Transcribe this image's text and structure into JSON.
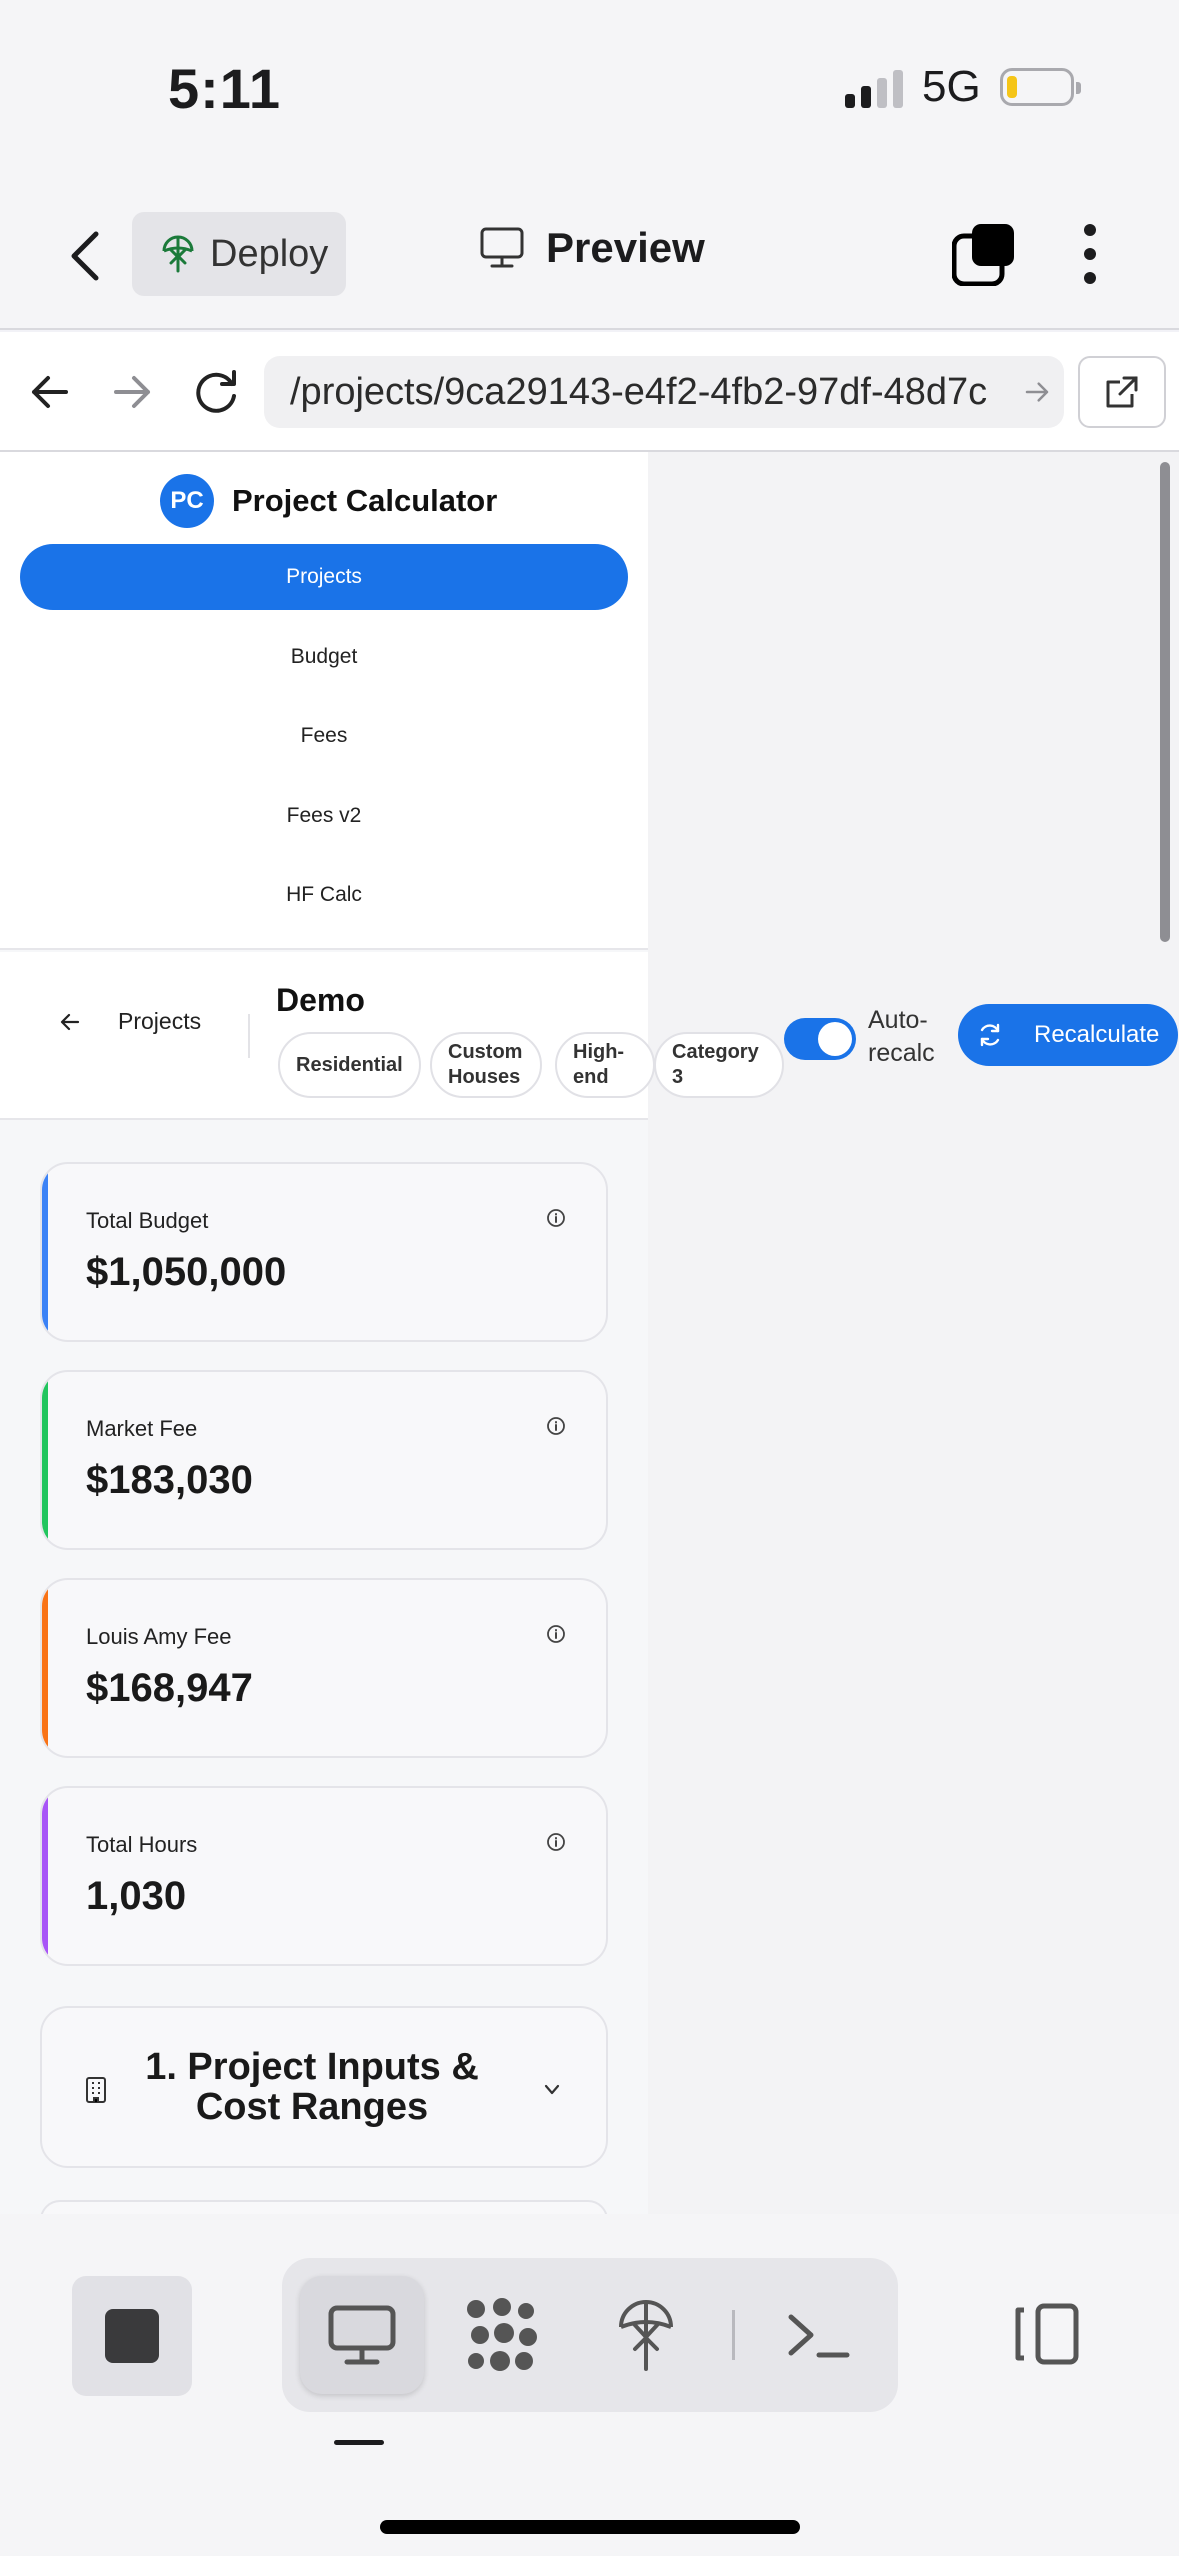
{
  "status_bar": {
    "time": "5:11",
    "network": "5G"
  },
  "top_bar": {
    "deploy_label": "Deploy",
    "preview_label": "Preview"
  },
  "url_bar": {
    "url": "/projects/9ca29143-e4f2-4fb2-97df-48d7c"
  },
  "app": {
    "brand_initials": "PC",
    "brand_name": "Project Calculator",
    "nav": [
      "Projects",
      "Budget",
      "Fees",
      "Fees v2",
      "HF Calc"
    ],
    "active_nav": "Projects"
  },
  "project": {
    "back_label": "Projects",
    "title": "Demo",
    "tags": [
      "Residential",
      "Custom Houses",
      "High-end",
      "Category 3"
    ],
    "auto_recalc_label": "Auto-recalc",
    "auto_recalc_on": true,
    "recalculate_label": "Recalculate"
  },
  "metrics": [
    {
      "label": "Total Budget",
      "value": "$1,050,000",
      "color": "#3b82f6"
    },
    {
      "label": "Market Fee",
      "value": "$183,030",
      "color": "#22c55e"
    },
    {
      "label": "Louis Amy Fee",
      "value": "$168,947",
      "color": "#f97316"
    },
    {
      "label": "Total Hours",
      "value": "1,030",
      "color": "#a855f7"
    }
  ],
  "section": {
    "title": "1. Project Inputs & Cost Ranges"
  },
  "bottom_tools": [
    "stop-icon",
    "desktop-icon",
    "dots-icon",
    "deploy-icon",
    "terminal-icon",
    "sidebar-toggle-icon"
  ],
  "colors": {
    "accent": "#1a73e8"
  }
}
